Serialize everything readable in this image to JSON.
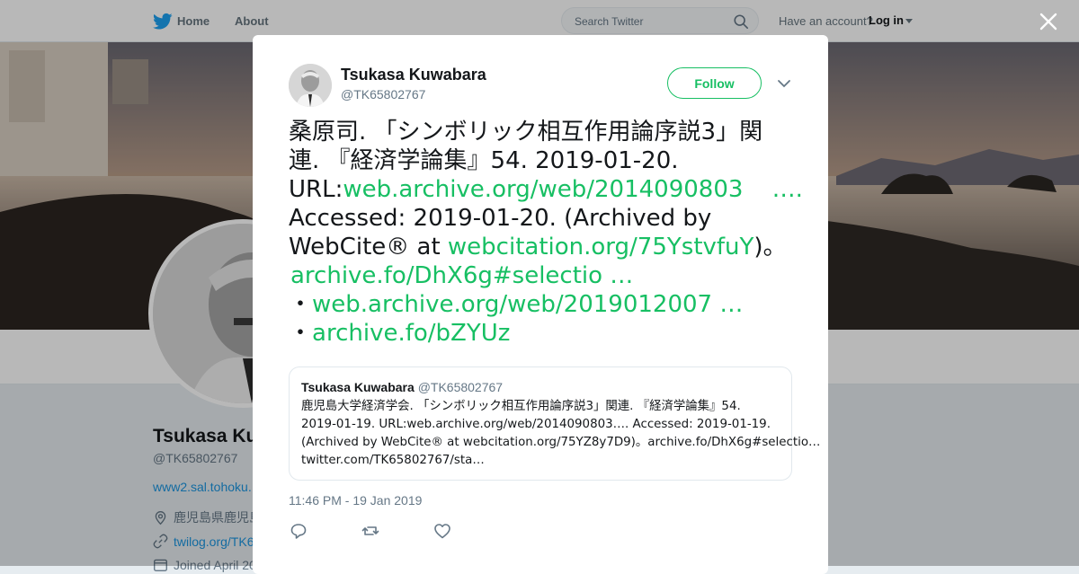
{
  "nav": {
    "home": "Home",
    "about": "About",
    "search_placeholder": "Search Twitter",
    "have_account": "Have an account?",
    "login": "Log in"
  },
  "profile": {
    "name": "Tsukasa Ku",
    "handle": "@TK65802767",
    "url": "www2.sal.tohoku.",
    "location": "鹿児島県鹿児島",
    "website": "twilog.org/TK6",
    "joined": "Joined April 20"
  },
  "tweet": {
    "author_name": "Tsukasa Kuwabara",
    "author_handle": "@TK65802767",
    "follow_label": "Follow",
    "text": {
      "l1": "桑原司. 「シンボリック相互作用論序説3」関",
      "l2": "連. 『経済学論集』54. 2019-01-20.",
      "l3_prefix": "URL:",
      "l3_link": "web.archive.org/web/2014090803",
      "l3_ellipsis": " ….",
      "l4": "Accessed: 2019-01-20. (Archived by",
      "l5_prefix": "WebCite® at ",
      "l5_link": "webcitation.org/75YstvfuY",
      "l5_suffix": ")。",
      "l6_link": "archive.fo/DhX6g#selectio …",
      "l7_bullet": "・",
      "l7_link": "web.archive.org/web/2019012007 …",
      "l8_bullet": "・",
      "l8_link": "archive.fo/bZYUz"
    },
    "timestamp": "11:46 PM - 19 Jan 2019"
  },
  "quote": {
    "name": "Tsukasa Kuwabara",
    "handle": "@TK65802767",
    "l1": "鹿児島大学経済学会. 「シンボリック相互作用論序説3」関連. 『経済学論集』54.",
    "l2": "2019-01-19.  URL:web.archive.org/web/2014090803….  Accessed: 2019-01-19.",
    "l3": "(Archived by WebCite® at webcitation.org/75YZ8y7D9)。archive.fo/DhX6g#selectio…",
    "l4": "twitter.com/TK65802767/sta…"
  },
  "icons": {
    "brand": "twitter-bird-icon",
    "reply": "reply-icon",
    "retweet": "retweet-icon",
    "like": "heart-icon",
    "close": "close-icon"
  },
  "colors": {
    "accent": "#17bf63",
    "twitter_blue": "#1da1f2",
    "text": "#14171a",
    "muted": "#657786"
  }
}
